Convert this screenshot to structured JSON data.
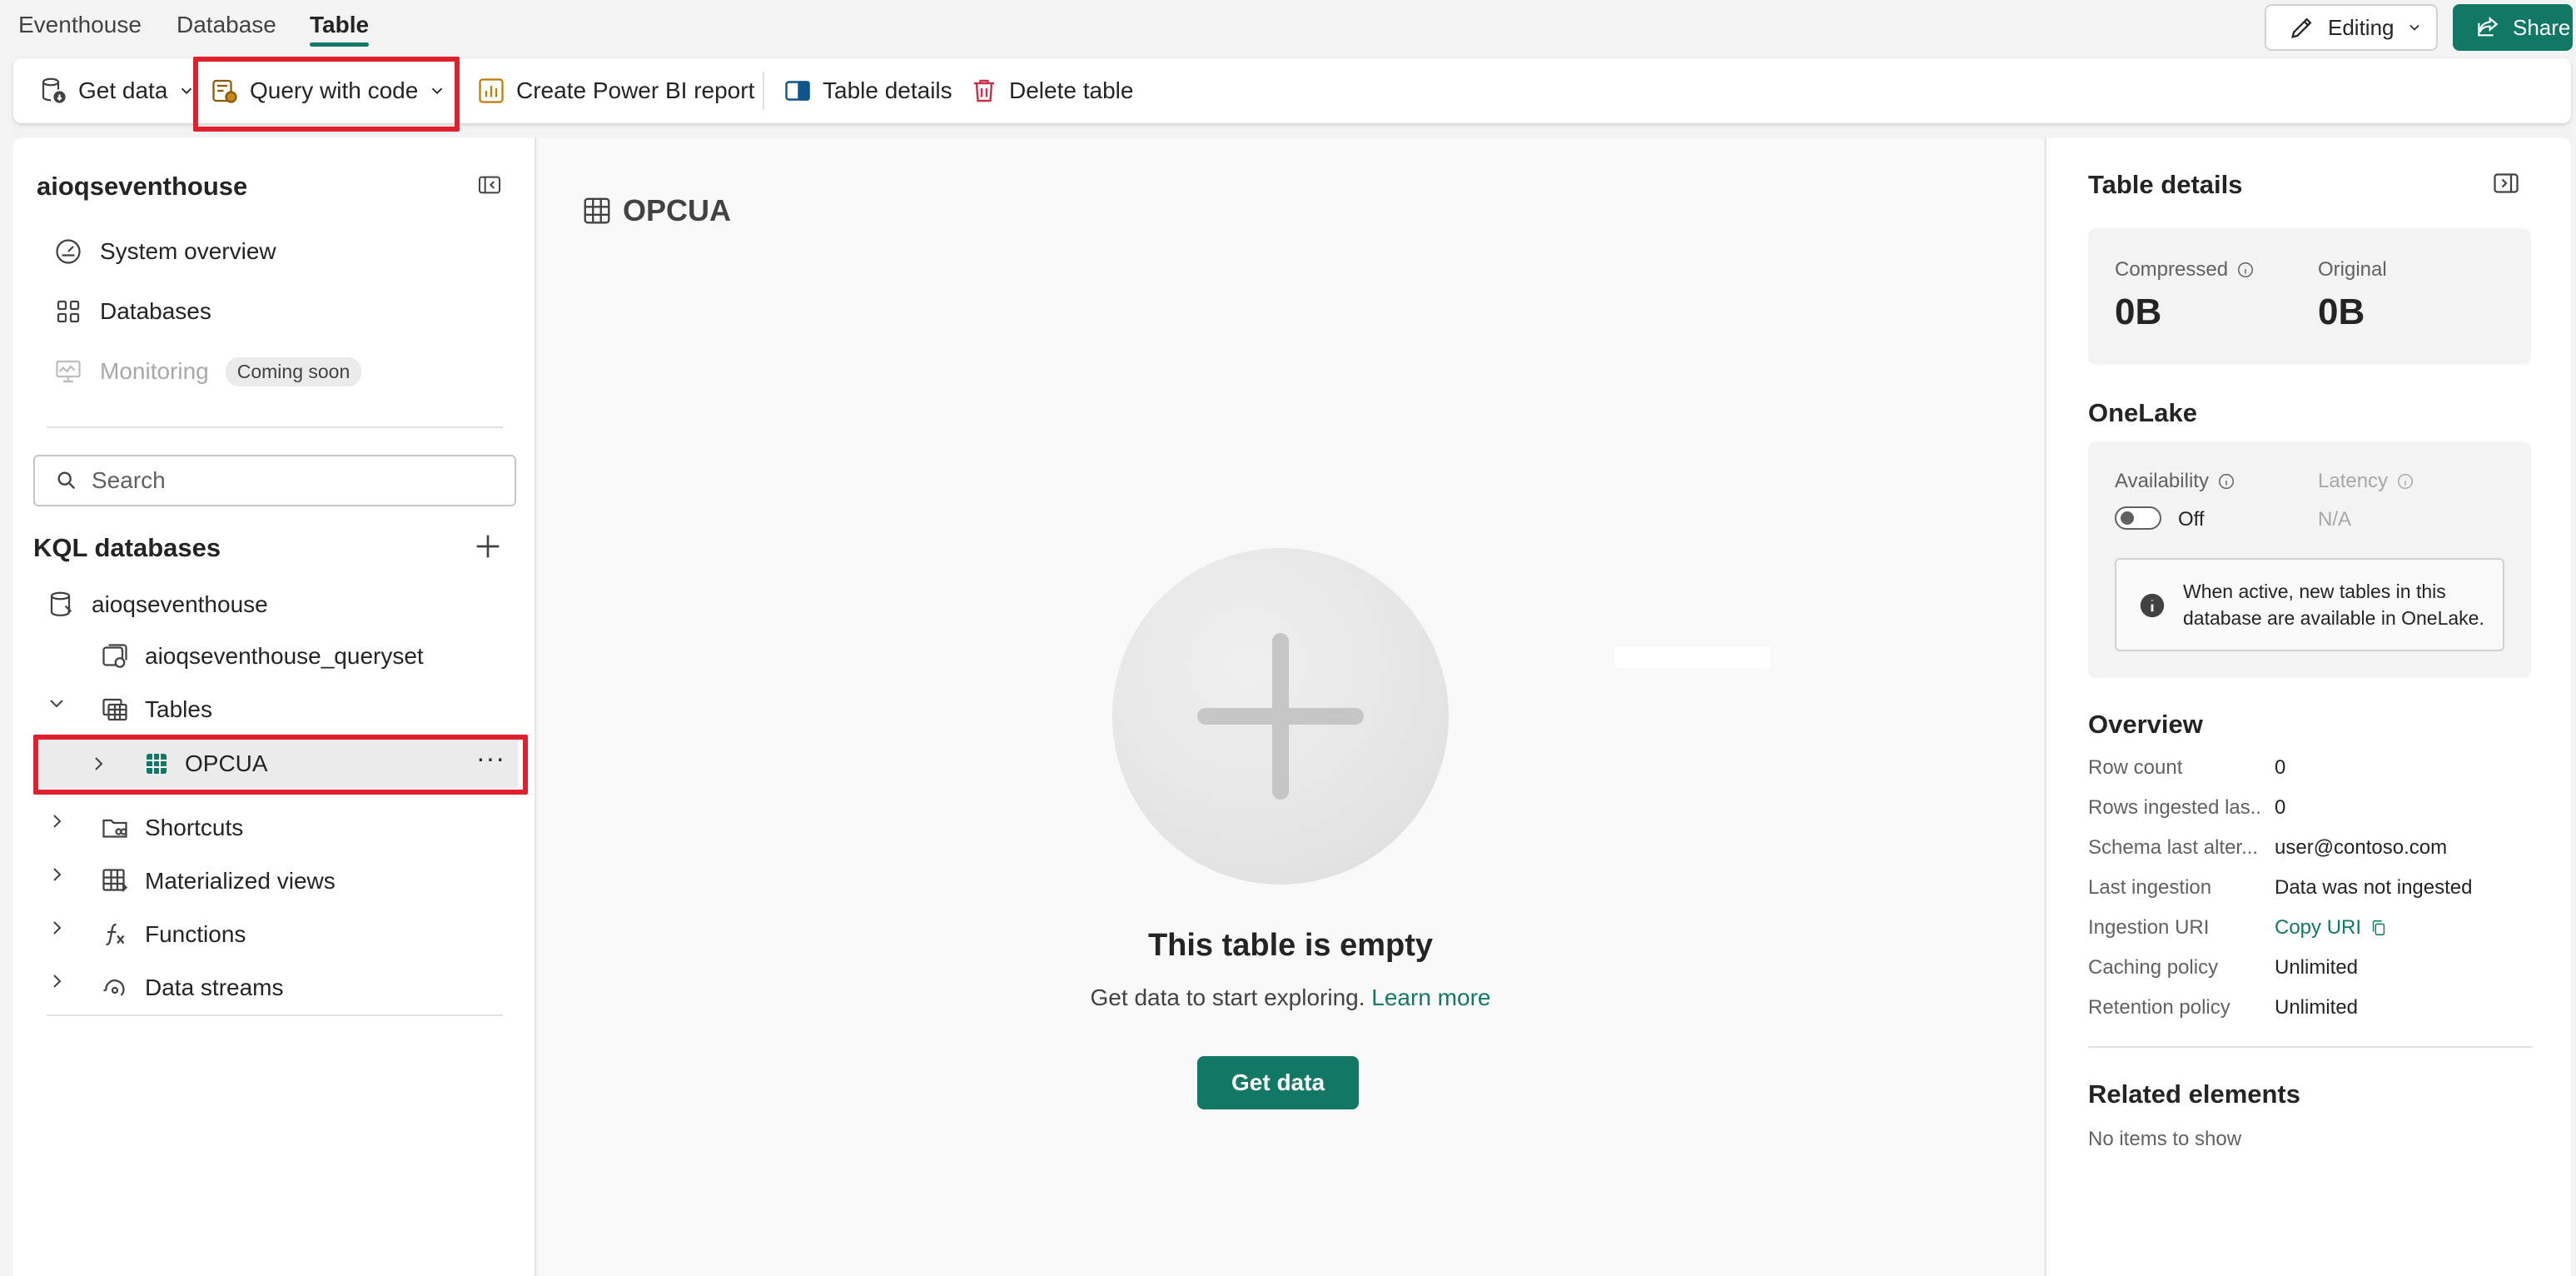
{
  "top_tabs": [
    {
      "label": "Eventhouse"
    },
    {
      "label": "Database"
    },
    {
      "label": "Table"
    }
  ],
  "editing_label": "Editing",
  "share_label": "Share",
  "toolbar": {
    "get_data": "Get data",
    "query_with_code": "Query with code",
    "create_power_bi_report": "Create Power BI report",
    "table_details": "Table details",
    "delete_table": "Delete table"
  },
  "left": {
    "eventhouse_name": "aioqseventhouse",
    "nav": {
      "system_overview": "System overview",
      "databases": "Databases",
      "monitoring": "Monitoring",
      "coming_soon": "Coming soon"
    },
    "search_placeholder": "Search",
    "kql_databases_title": "KQL databases",
    "tree": {
      "database": "aioqseventhouse",
      "queryset": "aioqseventhouse_queryset",
      "tables": "Tables",
      "table_opcua": "OPCUA",
      "shortcuts": "Shortcuts",
      "materialized_views": "Materialized views",
      "functions": "Functions",
      "data_streams": "Data streams"
    }
  },
  "center": {
    "table_name": "OPCUA",
    "empty_title": "This table is empty",
    "empty_subtitle": "Get data to start exploring.",
    "learn_more": "Learn more",
    "get_data_button": "Get data"
  },
  "right": {
    "title": "Table details",
    "compressed_label": "Compressed",
    "compressed_value": "0B",
    "original_label": "Original",
    "original_value": "0B",
    "onelake_title": "OneLake",
    "availability_label": "Availability",
    "availability_value": "Off",
    "latency_label": "Latency",
    "latency_value": "N/A",
    "onelake_info": "When active, new tables in this database are available in OneLake.",
    "overview_title": "Overview",
    "overview": [
      {
        "label": "Row count",
        "value": "0"
      },
      {
        "label": "Rows ingested las...",
        "value": "0"
      },
      {
        "label": "Schema last alter...",
        "value": "user@contoso.com"
      },
      {
        "label": "Last ingestion",
        "value": "Data was not ingested"
      },
      {
        "label": "Ingestion URI",
        "value": "Copy URI"
      },
      {
        "label": "Caching policy",
        "value": "Unlimited"
      },
      {
        "label": "Retention policy",
        "value": "Unlimited"
      }
    ],
    "related_title": "Related elements",
    "related_empty": "No items to show"
  },
  "colors": {
    "accent": "#117865",
    "highlight": "#e0202c"
  }
}
